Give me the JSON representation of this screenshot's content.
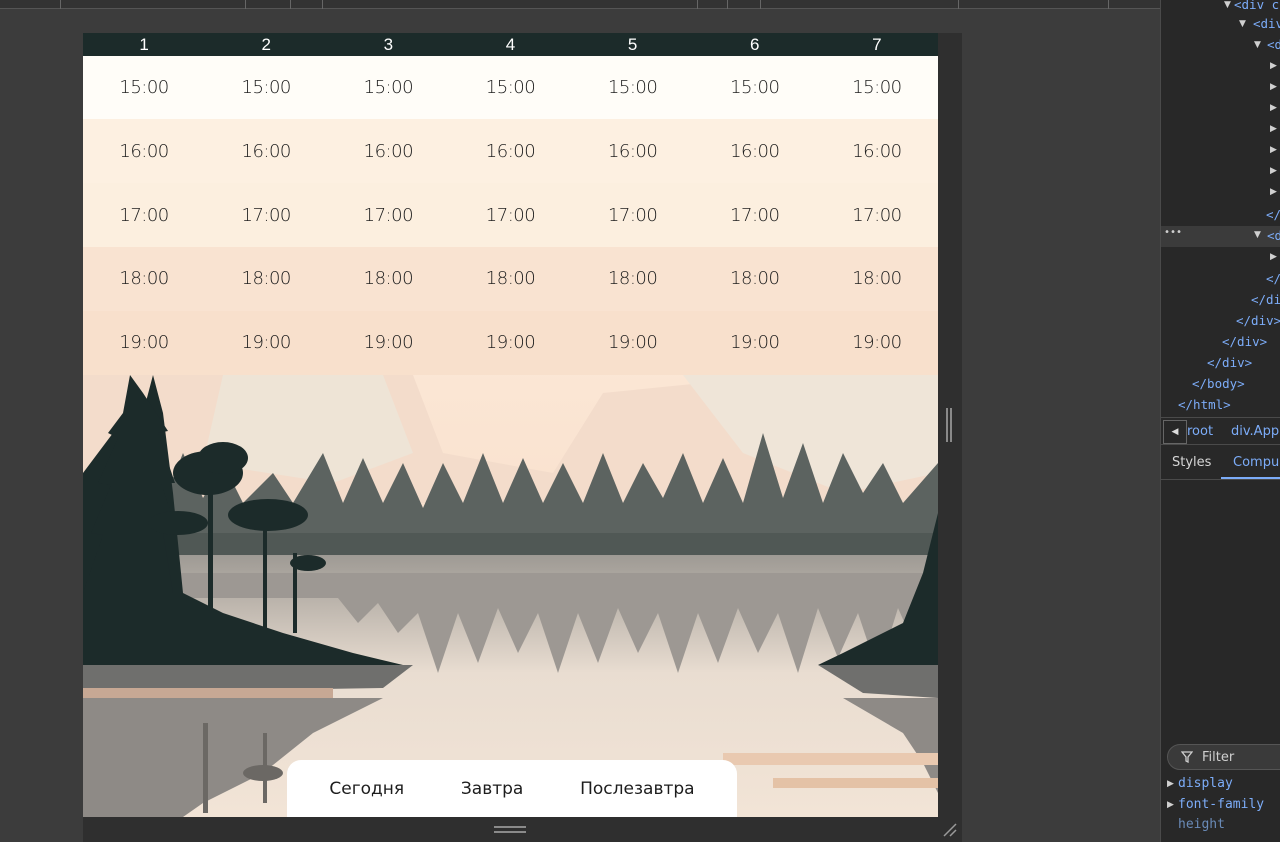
{
  "schedule": {
    "days": [
      "1",
      "2",
      "3",
      "4",
      "5",
      "6",
      "7"
    ],
    "times": [
      "15:00",
      "16:00",
      "17:00",
      "18:00",
      "19:00"
    ]
  },
  "day_selector": {
    "today": "Сегодня",
    "tomorrow": "Завтра",
    "day_after": "Послезавтра"
  },
  "devtools": {
    "dom_lines": [
      "<div c",
      "<div",
      "<d",
      "</",
      "<d",
      "</",
      "</di",
      "</div>",
      "</div>",
      "</div>",
      "</body>",
      "</html>"
    ],
    "selected_marker": "•••",
    "breadcrumb": {
      "root": "root",
      "app": "div.App"
    },
    "tabs": {
      "styles": "Styles",
      "computed": "Compu"
    },
    "filter_placeholder": "Filter",
    "properties": [
      "display",
      "font-family",
      "height"
    ]
  },
  "colors": {
    "header_bg": "#1c2b2a",
    "devtools_bg": "#282828",
    "devtools_accent": "#7cacf8",
    "page_bg": "#3c3c3c"
  }
}
